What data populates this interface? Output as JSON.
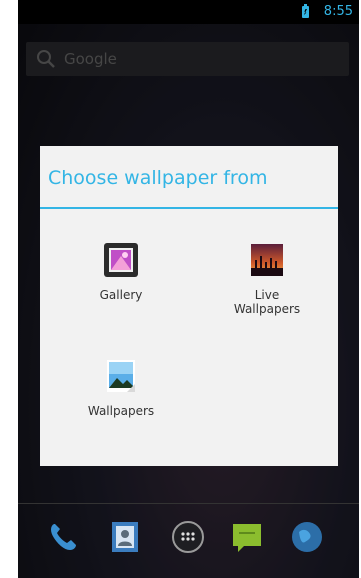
{
  "status_bar": {
    "time": "8:55"
  },
  "search": {
    "text": "Google"
  },
  "dialog": {
    "title": "Choose wallpaper from",
    "options": [
      {
        "label": "Gallery"
      },
      {
        "label_line1": "Live",
        "label_line2": "Wallpapers"
      },
      {
        "label": "Wallpapers"
      }
    ]
  },
  "dock": {
    "items": [
      "phone-icon",
      "contacts-icon",
      "all-apps-icon",
      "messaging-icon",
      "browser-icon"
    ]
  },
  "colors": {
    "accent": "#33b5e5",
    "dialog_bg": "#f2f2f2"
  }
}
